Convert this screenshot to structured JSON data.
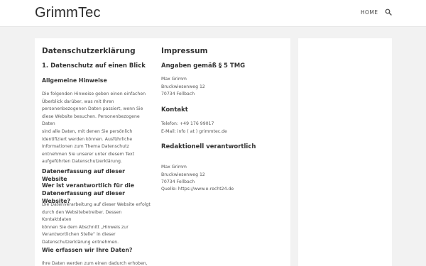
{
  "header": {
    "logo": "GrimmTec",
    "nav_home": "HOME",
    "search_icon": "search-icon"
  },
  "datenschutz": {
    "title": "Datenschutzerklärung",
    "section1_title": "1. Datenschutz auf einen Blick",
    "allgemein_title": "Allgemeine Hinweise",
    "allgemein_lines": [
      "Die folgenden Hinweise geben einen einfachen",
      "Überblick darüber, was mit Ihren",
      "personenbezogenen Daten passiert, wenn Sie",
      "diese Website besuchen. Personenbezogene Daten",
      "sind alle Daten, mit denen Sie persönlich",
      "identifiziert werden können. Ausführliche",
      "Informationen zum Thema Datenschutz",
      "entnehmen Sie unserer unter diesem Text",
      "aufgeführten Datenschutzerklärung."
    ],
    "erfassung_title": "Datenerfassung auf dieser Website",
    "wer_title_lines": [
      "Wer ist verantwortlich für die",
      "Datenerfassung auf dieser Website?"
    ],
    "wer_lines": [
      "Die Datenverarbeitung auf dieser Website erfolgt",
      "durch den Websitebetreiber. Dessen Kontaktdaten",
      "können Sie dem Abschnitt „Hinweis zur",
      "Verantwortlichen Stelle“ in dieser",
      "Datenschutzerklärung entnehmen."
    ],
    "wie_title": "Wie erfassen wir Ihre Daten?",
    "wie_lines": [
      "Ihre Daten werden zum einen dadurch erhoben,"
    ]
  },
  "impressum": {
    "title": "Impressum",
    "angaben_title": "Angaben gemäß § 5 TMG",
    "address1": [
      "Max Grimm",
      "Bruckwiesenweg 12",
      "70734 Fellbach"
    ],
    "kontakt_title": "Kontakt",
    "kontakt_lines": [
      "Telefon: +49 176 99017",
      "E-Mail: info ( at ) grimmtec.de"
    ],
    "redaktionell_title": "Redaktionell verantwortlich",
    "address2": [
      "Max Grimm",
      "Bruckwiesenweg 12",
      "70734 Fellbach"
    ],
    "quelle": "Quelle: https://www.e-recht24.de"
  }
}
